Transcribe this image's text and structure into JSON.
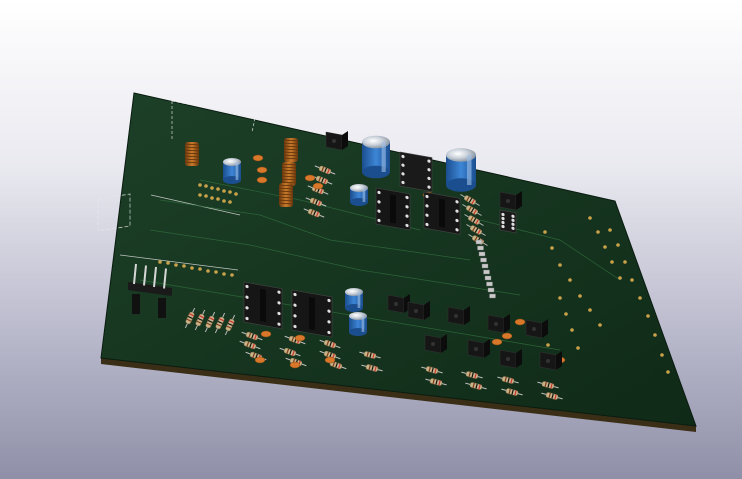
{
  "viewer": {
    "scene": "3d-pcb-render",
    "background_top": "#ffffff",
    "background_bottom": "#8f8fa8"
  },
  "board": {
    "color": "#15361f",
    "edge_color": "#3a2e16",
    "silkscreen_color": "#e8e8e8",
    "copper_color": "#c9a24a"
  },
  "components": {
    "electrolytic_capacitors": 6,
    "dip8_ic_sockets": 4,
    "to220_transistors": 9,
    "inductors": 4,
    "pin_header": "1x4 right-angle",
    "axial_resistors": "many",
    "capacitor_color": "#2a6fc0",
    "resistor_color": "#c9b48a",
    "ic_color": "#1a1a1a"
  }
}
